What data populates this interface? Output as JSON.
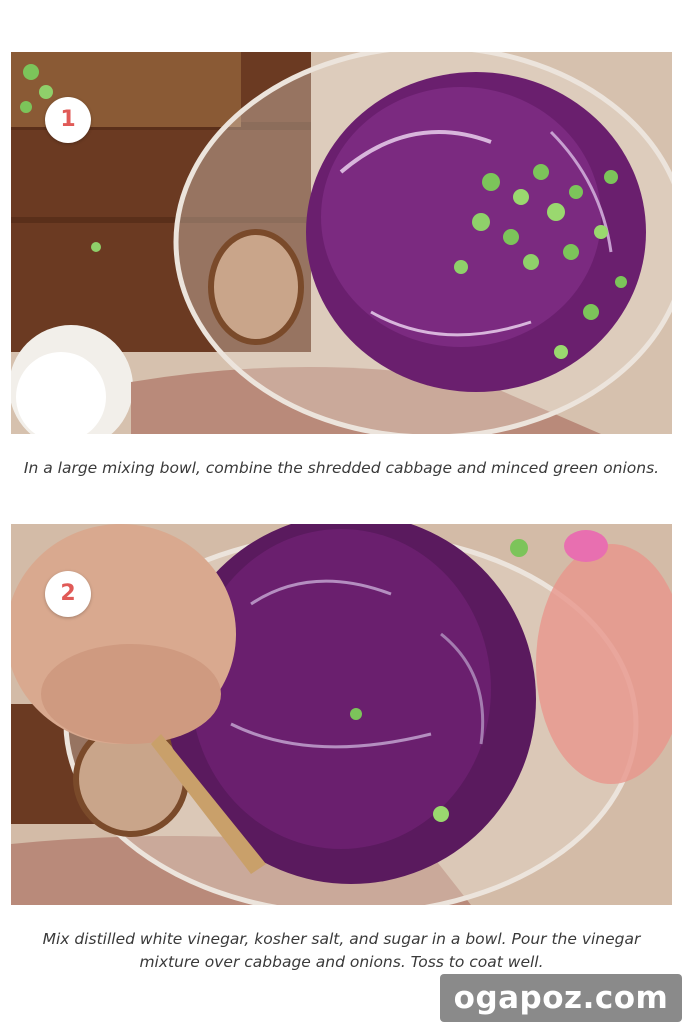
{
  "steps": [
    {
      "number": "1",
      "caption": "In a large mixing bowl, combine the shredded cabbage and minced green onions.",
      "photo_subject": "red cabbage and green onions in glass bowl"
    },
    {
      "number": "2",
      "caption": "Mix distilled white vinegar, kosher salt, and sugar in a bowl. Pour the vinegar mixture over cabbage and onions. Toss to coat well.",
      "photo_subject": "tossing cabbage with wooden spoon"
    }
  ],
  "watermark": "ogapoz.com",
  "colors": {
    "badge_text": "#e05a57",
    "cabbage": "#6a1f6e",
    "onion": "#7cc45a",
    "wood": "#6b3a22",
    "linen": "#b98a7a",
    "background": "#d6c1ae"
  }
}
